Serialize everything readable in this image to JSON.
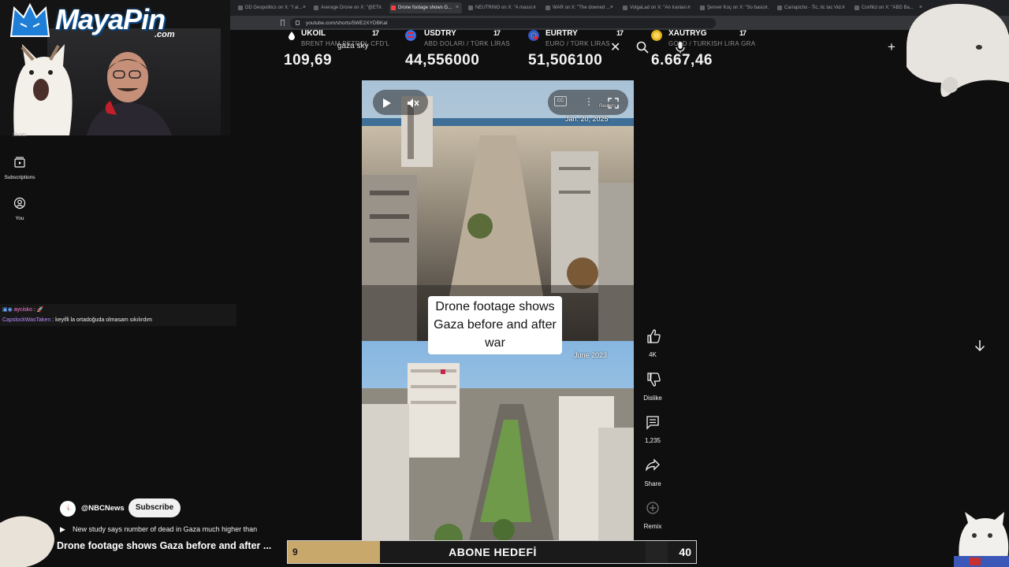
{
  "browser": {
    "tabs": [
      {
        "label": "DD Geopolitics on X: \"I al...",
        "active": false
      },
      {
        "label": "Average Drone on X: \"@ET...",
        "active": false
      },
      {
        "label": "Drone footage shows G...",
        "active": true
      },
      {
        "label": "NEUTRINO on X: \"A massi...",
        "active": false
      },
      {
        "label": "WAR on X: \"The downed ...",
        "active": false
      },
      {
        "label": "VolgaLad on X: \"An Iranian...",
        "active": false
      },
      {
        "label": "Şenver Koç on X: \"So basic...",
        "active": false
      },
      {
        "label": "Carrapicho - Tic, tic tac Vid...",
        "active": false
      },
      {
        "label": "Conflict on X: \"ABD Ba...",
        "active": false
      }
    ],
    "url": "youtube.com/shorts/5WE2XYDBKaI"
  },
  "ticker": [
    {
      "symbol": "UKOIL",
      "subtitle": "BRENT HAM PETROL CFD'L",
      "value": "109,69",
      "icon_color": "#222222"
    },
    {
      "symbol": "USDTRY",
      "subtitle": "ABD DOLARI / TÜRK LİRAS",
      "value": "44,556000",
      "icon_color": "#3c6ee0"
    },
    {
      "symbol": "EURTRY",
      "subtitle": "EURO / TÜRK LİRAS",
      "value": "51,506100",
      "icon_color": "#2f5ac8"
    },
    {
      "symbol": "XAUTRYG",
      "subtitle": "GOLD / TURKISH LIRA GRA",
      "value": "6.667,46",
      "icon_color": "#e7b51e"
    }
  ],
  "youtube": {
    "search_query": "gaza sky",
    "brand_logo": "MayaPin",
    "brand_suffix": ".com",
    "sidebar": [
      {
        "label": "Subscriptions",
        "icon": "subscriptions-icon"
      },
      {
        "label": "You",
        "icon": "you-icon"
      }
    ],
    "sidebar_partial_label": "Shorts"
  },
  "chat": [
    {
      "user": "aycisko",
      "sep": " : ",
      "message": "🚀"
    },
    {
      "user": "CapslockWasTaken",
      "sep": " : ",
      "message": "keyifli la ortadoğuda olmasam sıkılırdım"
    }
  ],
  "video": {
    "caption": "Drone footage shows Gaza before and after war",
    "date_top": "Jan. 20, 2025",
    "date_bottom": "June 2023",
    "watermark": "Reuters",
    "cc_label": "CC"
  },
  "actions": [
    {
      "name": "like",
      "label": "4K",
      "icon": "thumbs-up-icon"
    },
    {
      "name": "dislike",
      "label": "Dislike",
      "icon": "thumbs-down-icon"
    },
    {
      "name": "comments",
      "label": "1,235",
      "icon": "comment-icon"
    },
    {
      "name": "share",
      "label": "Share",
      "icon": "share-icon"
    },
    {
      "name": "remix",
      "label": "Remix",
      "icon": "remix-icon"
    }
  ],
  "channel": {
    "handle": "@NBCNews",
    "subscribe_label": "Subscribe",
    "description_line": "New study says number of dead in Gaza much higher than",
    "title": "Drone footage shows Gaza before and after ..."
  },
  "goal": {
    "current": "9",
    "label": "ABONE HEDEFİ",
    "target": "40",
    "progress": 0.225,
    "fill_color": "#c9a86c"
  }
}
